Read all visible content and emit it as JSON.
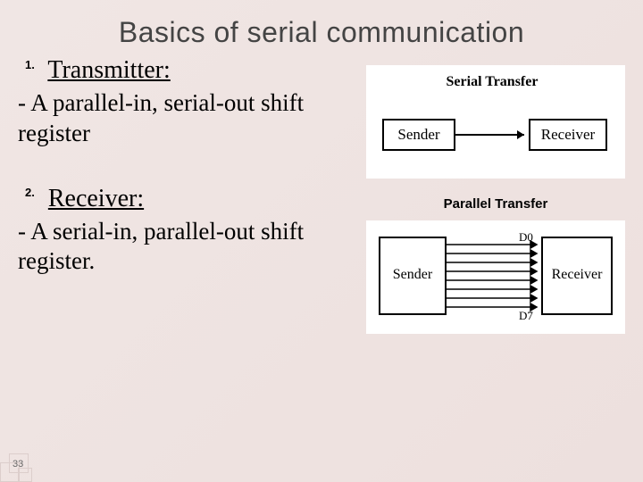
{
  "title": "Basics of serial communication",
  "section1": {
    "num": "1.",
    "heading": "Transmitter:",
    "body": "- A parallel-in, serial-out shift register"
  },
  "section2": {
    "num": "2.",
    "heading": "Receiver:",
    "body": "- A serial-in, parallel-out shift register."
  },
  "diagram1": {
    "title": "Serial Transfer",
    "sender": "Sender",
    "receiver": "Receiver"
  },
  "diagram2": {
    "title": "Parallel Transfer",
    "sender": "Sender",
    "receiver": "Receiver",
    "line_top": "D0",
    "line_bottom": "D7"
  },
  "page_number": "33"
}
